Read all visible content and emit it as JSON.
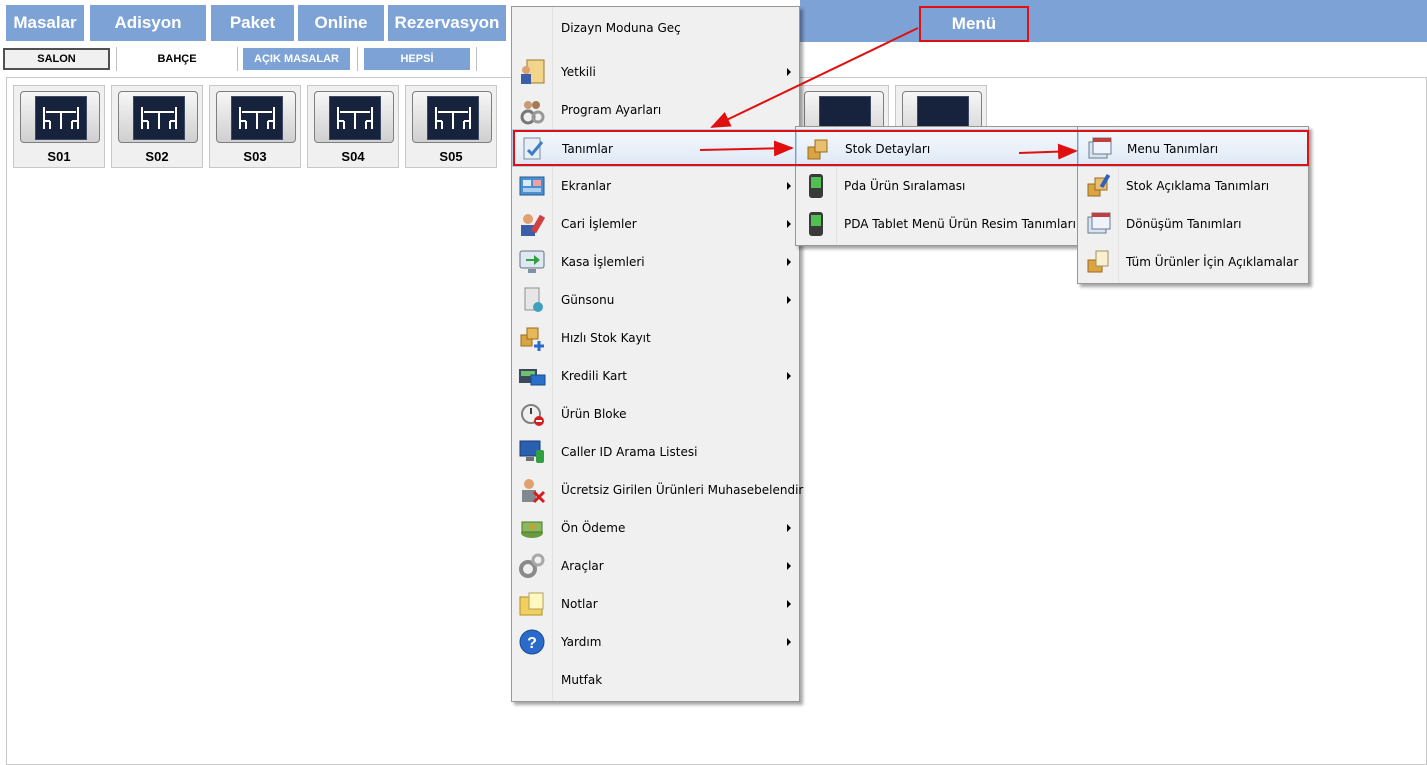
{
  "top_tabs": {
    "masalar": "Masalar",
    "adisyon": "Adisyon",
    "paket": "Paket",
    "online": "Online",
    "rezervasyon": "Rezervasyon",
    "menu": "Menü"
  },
  "sub_tabs": {
    "salon": "SALON",
    "bahce": "BAHÇE",
    "acik_masalar": "AÇIK MASALAR",
    "hepsi": "HEPSİ"
  },
  "tables": [
    "S01",
    "S02",
    "S03",
    "S04",
    "S05"
  ],
  "main_menu": {
    "items": [
      {
        "label": "Dizayn Moduna Geç",
        "icon": "none"
      },
      {
        "label": "Yetkili",
        "icon": "users-card-icon"
      },
      {
        "label": "Program Ayarları",
        "icon": "gear-people-icon"
      },
      {
        "label": "Tanımlar",
        "icon": "clipboard-check-icon"
      },
      {
        "label": "Ekranlar",
        "icon": "screens-icon"
      },
      {
        "label": "Cari İşlemler",
        "icon": "person-tools-icon"
      },
      {
        "label": "Kasa İşlemleri",
        "icon": "monitor-arrow-icon"
      },
      {
        "label": "Günsonu",
        "icon": "report-icon"
      },
      {
        "label": "Hızlı Stok Kayıt",
        "icon": "boxes-plus-icon"
      },
      {
        "label": "Kredili Kart",
        "icon": "card-reader-icon"
      },
      {
        "label": "Ürün Bloke",
        "icon": "timer-block-icon"
      },
      {
        "label": "Caller ID Arama Listesi",
        "icon": "computer-phone-icon"
      },
      {
        "label": "Ücretsiz Girilen Ürünleri Muhasebelendir",
        "icon": "person-cancel-icon"
      },
      {
        "label": "Ön Ödeme",
        "icon": "money-icon"
      },
      {
        "label": "Araçlar",
        "icon": "gears-icon"
      },
      {
        "label": "Notlar",
        "icon": "folder-note-icon"
      },
      {
        "label": "Yardım",
        "icon": "help-icon"
      },
      {
        "label": "Mutfak",
        "icon": "none"
      }
    ]
  },
  "submenu_tanimlar": {
    "items": [
      {
        "label": "Stok Detayları",
        "icon": "boxes-icon"
      },
      {
        "label": "Pda Ürün Sıralaması",
        "icon": "pda-icon"
      },
      {
        "label": "PDA Tablet Menü Ürün Resim Tanımları",
        "icon": "pda-icon"
      }
    ]
  },
  "submenu_stok": {
    "items": [
      {
        "label": "Menu Tanımları",
        "icon": "window-stack-icon"
      },
      {
        "label": "Stok Açıklama Tanımları",
        "icon": "boxes-pencil-icon"
      },
      {
        "label": "Dönüşüm Tanımları",
        "icon": "window-stack-icon"
      },
      {
        "label": "Tüm Ürünler İçin Açıklamalar",
        "icon": "box-note-icon"
      }
    ]
  },
  "colors": {
    "tab_blue": "#7da2d6",
    "menu_bg": "#f0f0f0",
    "highlight_border": "#b6cde8",
    "annotation_red": "#e01010"
  }
}
